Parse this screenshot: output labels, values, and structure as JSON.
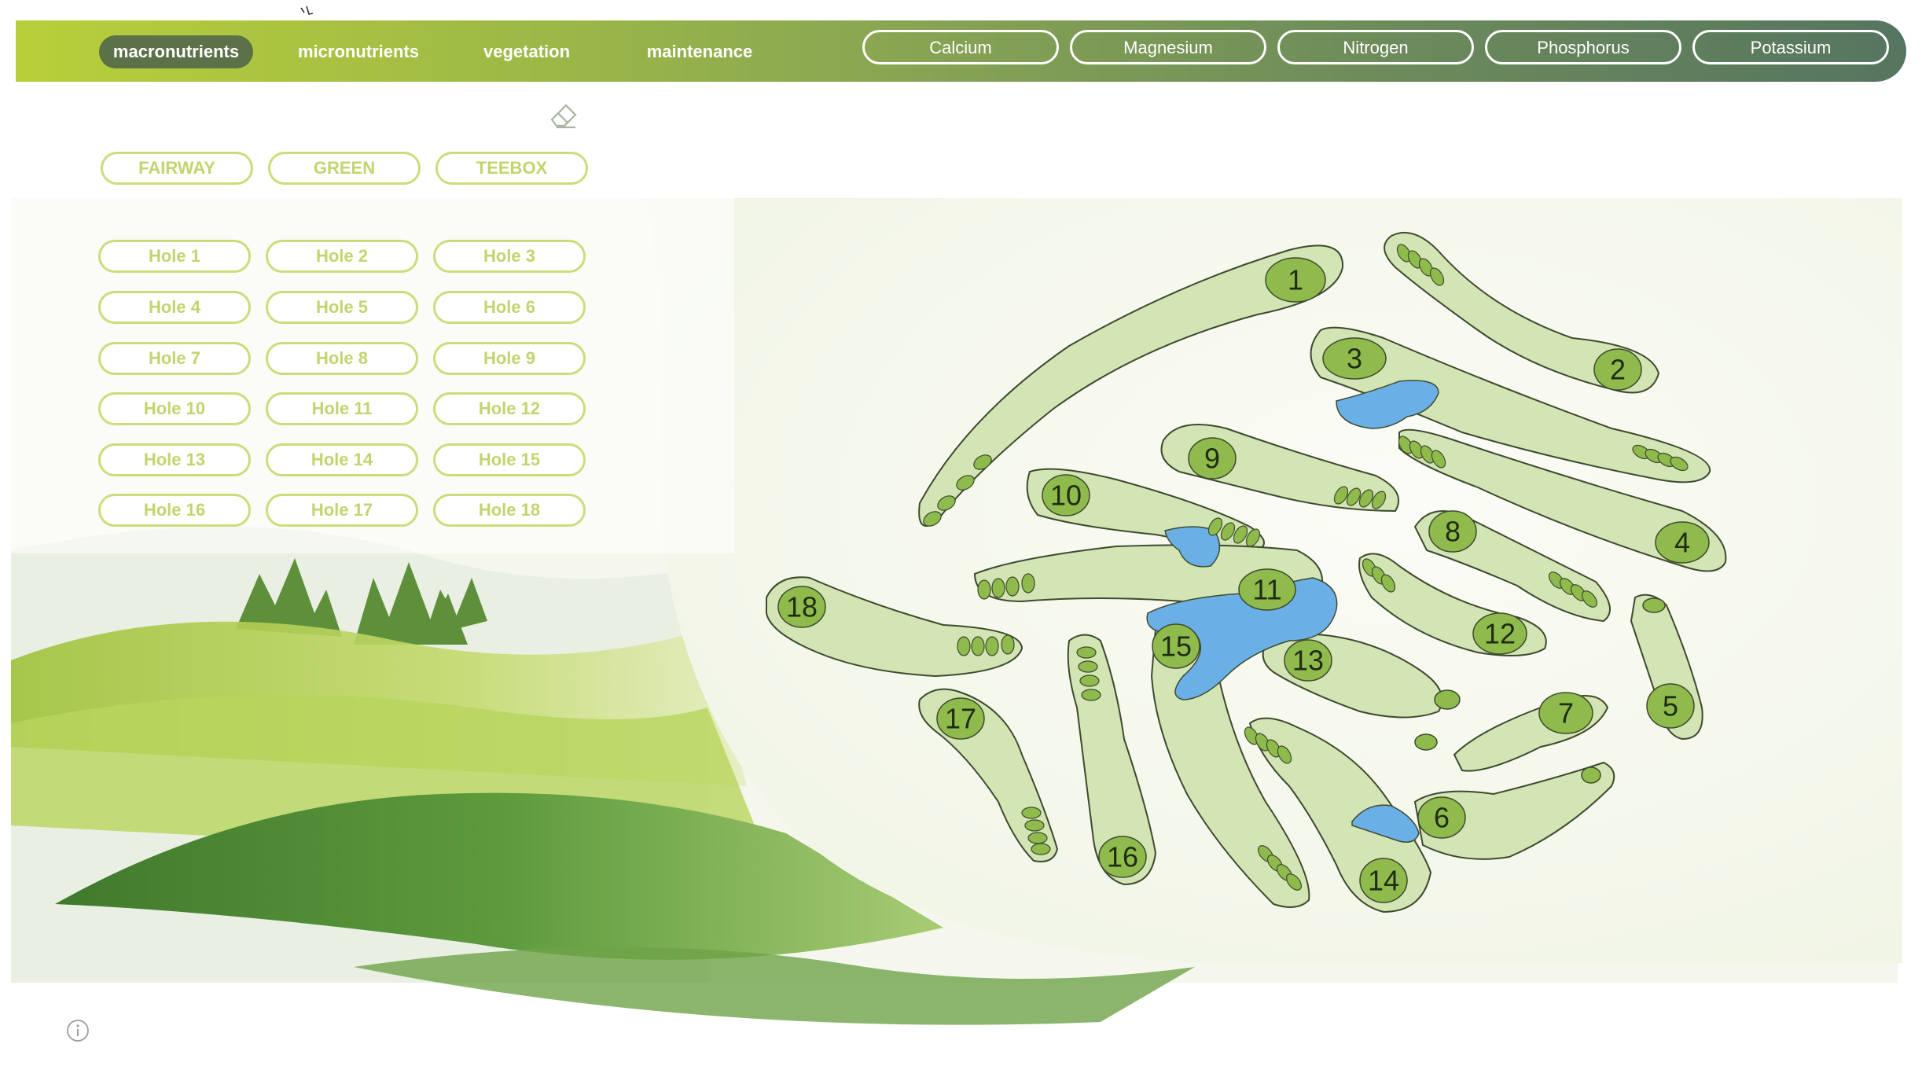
{
  "nav": {
    "tabs": [
      "macronutrients",
      "micronutrients",
      "vegetation",
      "maintenance"
    ],
    "active": "macronutrients"
  },
  "nutrients": [
    "Calcium",
    "Magnesium",
    "Nitrogen",
    "Phosphorus",
    "Potassium"
  ],
  "area_filters": [
    "FAIRWAY",
    "GREEN",
    "TEEBOX"
  ],
  "hole_filters": [
    "Hole 1",
    "Hole 2",
    "Hole 3",
    "Hole 4",
    "Hole 5",
    "Hole 6",
    "Hole 7",
    "Hole 8",
    "Hole 9",
    "Hole 10",
    "Hole 11",
    "Hole 12",
    "Hole 13",
    "Hole 14",
    "Hole 15",
    "Hole 16",
    "Hole 17",
    "Hole 18"
  ],
  "course_labels": {
    "h1": "1",
    "h2": "2",
    "h3": "3",
    "h4": "4",
    "h5": "5",
    "h6": "6",
    "h7": "7",
    "h8": "8",
    "h9": "9",
    "h10": "10",
    "h11": "11",
    "h12": "12",
    "h13": "13",
    "h14": "14",
    "h15": "15",
    "h16": "16",
    "h17": "17",
    "h18": "18"
  },
  "colors": {
    "accent": "#b9cf3a",
    "nav_active": "#5b7148",
    "pill_border": "#cddc7a",
    "pill_text": "#c5d36e",
    "fairway": "#d3e4b5",
    "green": "#8fbb4c",
    "water": "#6ab0e6"
  },
  "icons": [
    "eraser-icon",
    "info-icon"
  ]
}
